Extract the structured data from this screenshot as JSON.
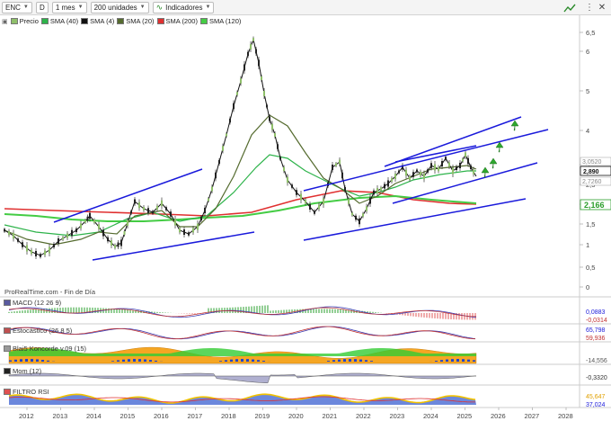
{
  "toolbar": {
    "ticker": "ENC",
    "period_type": "D",
    "timeframe": "1 mes",
    "units": "200 unidades",
    "indicators": "Indicadores"
  },
  "legend": [
    {
      "label": "Precio",
      "color": "#8fbf6a"
    },
    {
      "label": "SMA (40)",
      "color": "#2db34a"
    },
    {
      "label": "SMA (4)",
      "color": "#111111"
    },
    {
      "label": "SMA (20)",
      "color": "#556b2f"
    },
    {
      "label": "SMA (200)",
      "color": "#e03030"
    },
    {
      "label": "SMA (120)",
      "color": "#44cc44"
    }
  ],
  "price_axis": [
    "6,5",
    "6",
    "5",
    "4",
    "3",
    "2,5",
    "2",
    "1,5",
    "1",
    "0,5",
    "0"
  ],
  "price_tags": [
    {
      "text": "3,0520",
      "color": "#888888"
    },
    {
      "text": "2,890",
      "color": "#111111"
    },
    {
      "text": "2,7260",
      "color": "#888888"
    },
    {
      "text": "2,166",
      "color": "#2a9d2a"
    }
  ],
  "source": "ProRealTime.com - Fin de Día",
  "panes": {
    "macd": {
      "label": "MACD (12 26 9)",
      "values": [
        "0,0883",
        "-0,0314"
      ]
    },
    "stoch": {
      "label": "Estocástico (26 8 5)",
      "values": [
        "65,798",
        "59,936"
      ]
    },
    "blai": {
      "label": "Blai5 Koncorde v.09 (15)",
      "values": [
        "-14,556"
      ]
    },
    "mom": {
      "label": "Mom (12)",
      "values": [
        "-0,3320"
      ]
    },
    "filtro": {
      "label": "FILTRO RSI",
      "values": [
        "45,647",
        "37,024"
      ]
    }
  },
  "years": [
    "2012",
    "2013",
    "2014",
    "2015",
    "2016",
    "2017",
    "2018",
    "2019",
    "2020",
    "2021",
    "2022",
    "2023",
    "2024",
    "2025",
    "2026",
    "2027",
    "2028"
  ],
  "colors": {
    "trend_line": "#1a1adb",
    "arrow": "#2ea82e",
    "sma200": "#e03030",
    "sma120": "#44cc44",
    "sma40": "#2db34a",
    "sma20": "#556b2f",
    "price": "#111111"
  }
}
